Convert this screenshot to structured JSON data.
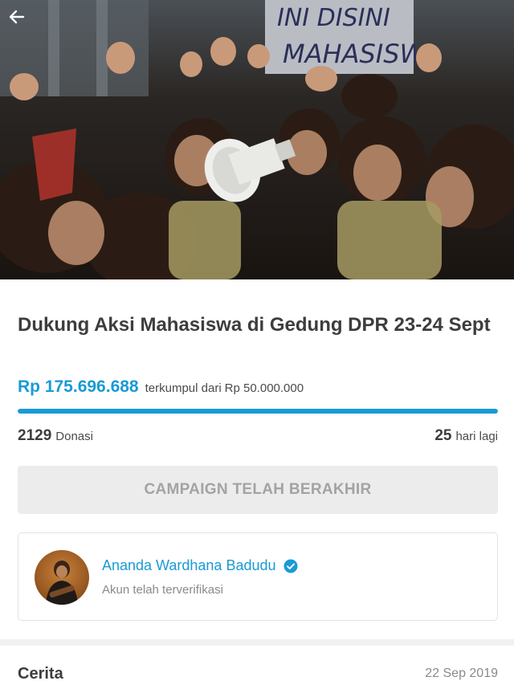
{
  "hero": {
    "image": "Crowd of students raising fists with megaphone at protest",
    "banner_text_line1": "INI DISINI",
    "banner_text_line2": "MAHASISWA",
    "back_icon": "arrow-left-icon"
  },
  "campaign": {
    "title": "Dukung Aksi Mahasiswa di Gedung DPR 23-24 Sept",
    "amount_raised": "Rp 175.696.688",
    "target_label": "terkumpul dari",
    "target_value": "Rp 50.000.000",
    "progress_fraction": 1.0,
    "donations_count": "2129",
    "donations_label": "Donasi",
    "days_left": "25",
    "days_left_label": "hari lagi",
    "status_button": "CAMPAIGN TELAH BERAKHIR"
  },
  "organizer": {
    "name": "Ananda Wardhana Badudu",
    "subtitle": "Akun telah terverifikasi",
    "verified_icon": "verified-check-icon"
  },
  "story": {
    "heading": "Cerita",
    "date": "22 Sep 2019"
  },
  "colors": {
    "accent": "#1a9ad6",
    "button_bg": "#ececec",
    "button_text": "#a3a3a3"
  }
}
